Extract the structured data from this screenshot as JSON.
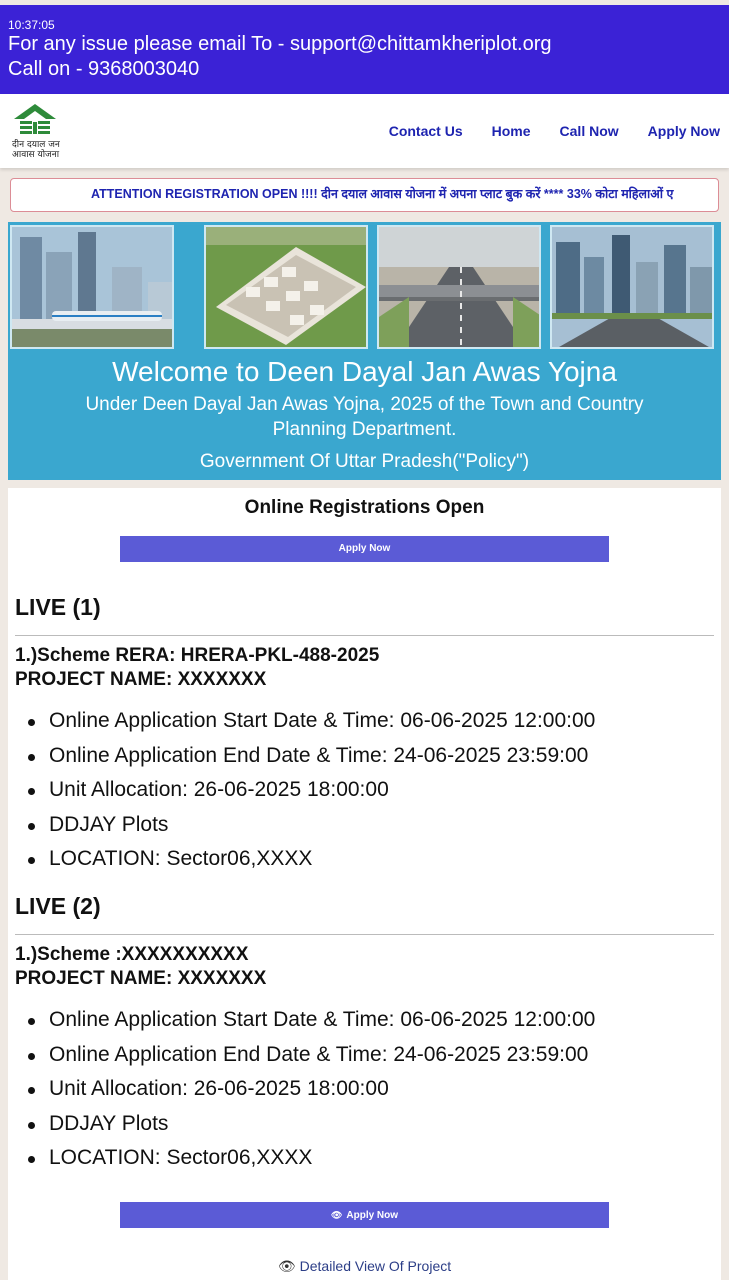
{
  "status_bar": {
    "time": "10:37:05"
  },
  "banner": {
    "email_line": "For any issue please email To - support@chittamkheriplot.org",
    "call_line": "Call on - 9368003040"
  },
  "header": {
    "logo_text_line1": "दीन दयाल जन",
    "logo_text_line2": "आवास योजना",
    "nav": [
      "Contact Us",
      "Home",
      "Call Now",
      "Apply Now"
    ]
  },
  "ticker": {
    "text": "ATTENTION REGISTRATION OPEN !!!! दीन दयाल आवास योजना में अपना प्लाट बुक करें **** 33% कोटा महिलाओं ए"
  },
  "hero": {
    "title": "Welcome to Deen Dayal Jan Awas Yojna",
    "subtitle": "Under Deen Dayal Jan Awas Yojna, 2025 of the Town and Country Planning Department.",
    "government": "Government Of Uttar Pradesh(\"Policy\")"
  },
  "registration": {
    "title": "Online Registrations Open",
    "apply_label": "Apply Now"
  },
  "live_sections": [
    {
      "heading": "LIVE (1)",
      "scheme": "1.)Scheme RERA: HRERA-PKL-488-2025",
      "project": "PROJECT NAME: XXXXXXX",
      "items": [
        "Online Application Start Date & Time: 06-06-2025 12:00:00",
        "Online Application End Date & Time: 24-06-2025 23:59:00",
        "Unit Allocation: 26-06-2025 18:00:00",
        "DDJAY Plots",
        "LOCATION: Sector06,XXXX"
      ]
    },
    {
      "heading": "LIVE (2)",
      "scheme": "1.)Scheme :XXXXXXXXXX",
      "project": "PROJECT NAME: XXXXXXX",
      "items": [
        "Online Application Start Date & Time: 06-06-2025 12:00:00",
        "Online Application End Date & Time: 24-06-2025 23:59:00",
        "Unit Allocation: 26-06-2025 18:00:00",
        "DDJAY Plots",
        "LOCATION: Sector06,XXXX"
      ]
    }
  ],
  "footer_actions": {
    "apply_label": "Apply Now",
    "detail_label": "Detailed View Of Project"
  },
  "colors": {
    "banner": "#3b22d6",
    "nav_link": "#1e24b0",
    "hero": "#3aa7cf",
    "button": "#5b5bd6"
  },
  "icons": [
    "house-logo-icon",
    "eye-icon"
  ]
}
